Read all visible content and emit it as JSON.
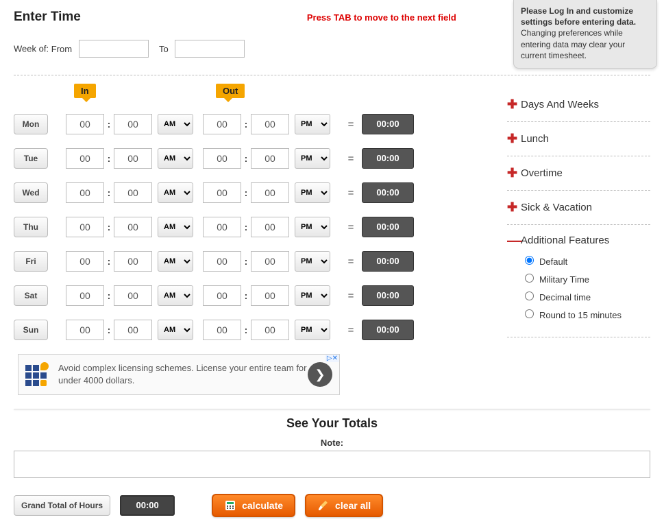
{
  "header": {
    "title": "Enter Time",
    "tab_hint": "Press TAB to move to the next field"
  },
  "tooltip": {
    "strong": "Please Log In and customize settings before entering data.",
    "rest": "Changing preferences while entering data may clear your current timesheet."
  },
  "week": {
    "label": "Week of:",
    "from_label": "From",
    "to_label": "To",
    "from_value": "",
    "to_value": ""
  },
  "tags": {
    "in": "In",
    "out": "Out"
  },
  "ampm_options": [
    "AM",
    "PM"
  ],
  "days": [
    {
      "name": "Mon",
      "in_h": "00",
      "in_m": "00",
      "in_ampm": "AM",
      "out_h": "00",
      "out_m": "00",
      "out_ampm": "PM",
      "total": "00:00"
    },
    {
      "name": "Tue",
      "in_h": "00",
      "in_m": "00",
      "in_ampm": "AM",
      "out_h": "00",
      "out_m": "00",
      "out_ampm": "PM",
      "total": "00:00"
    },
    {
      "name": "Wed",
      "in_h": "00",
      "in_m": "00",
      "in_ampm": "AM",
      "out_h": "00",
      "out_m": "00",
      "out_ampm": "PM",
      "total": "00:00"
    },
    {
      "name": "Thu",
      "in_h": "00",
      "in_m": "00",
      "in_ampm": "AM",
      "out_h": "00",
      "out_m": "00",
      "out_ampm": "PM",
      "total": "00:00"
    },
    {
      "name": "Fri",
      "in_h": "00",
      "in_m": "00",
      "in_ampm": "AM",
      "out_h": "00",
      "out_m": "00",
      "out_ampm": "PM",
      "total": "00:00"
    },
    {
      "name": "Sat",
      "in_h": "00",
      "in_m": "00",
      "in_ampm": "AM",
      "out_h": "00",
      "out_m": "00",
      "out_ampm": "PM",
      "total": "00:00"
    },
    {
      "name": "Sun",
      "in_h": "00",
      "in_m": "00",
      "in_ampm": "AM",
      "out_h": "00",
      "out_m": "00",
      "out_ampm": "PM",
      "total": "00:00"
    }
  ],
  "ad": {
    "line": "Avoid complex licensing schemes. License your entire team for under 4000 dollars.",
    "corner": "▷✕"
  },
  "sidebar": {
    "items": [
      {
        "label": "Days And Weeks",
        "open": false
      },
      {
        "label": "Lunch",
        "open": false
      },
      {
        "label": "Overtime",
        "open": false
      },
      {
        "label": "Sick & Vacation",
        "open": false
      },
      {
        "label": "Additional Features",
        "open": true
      }
    ],
    "features": [
      {
        "label": "Default",
        "checked": true
      },
      {
        "label": "Military Time",
        "checked": false
      },
      {
        "label": "Decimal time",
        "checked": false
      },
      {
        "label": "Round to 15 minutes",
        "checked": false
      }
    ]
  },
  "totals": {
    "title": "See Your Totals",
    "note_label": "Note:",
    "note_value": "",
    "grand_label": "Grand Total of Hours",
    "grand_value": "00:00",
    "calculate": "calculate",
    "clear": "clear all"
  }
}
